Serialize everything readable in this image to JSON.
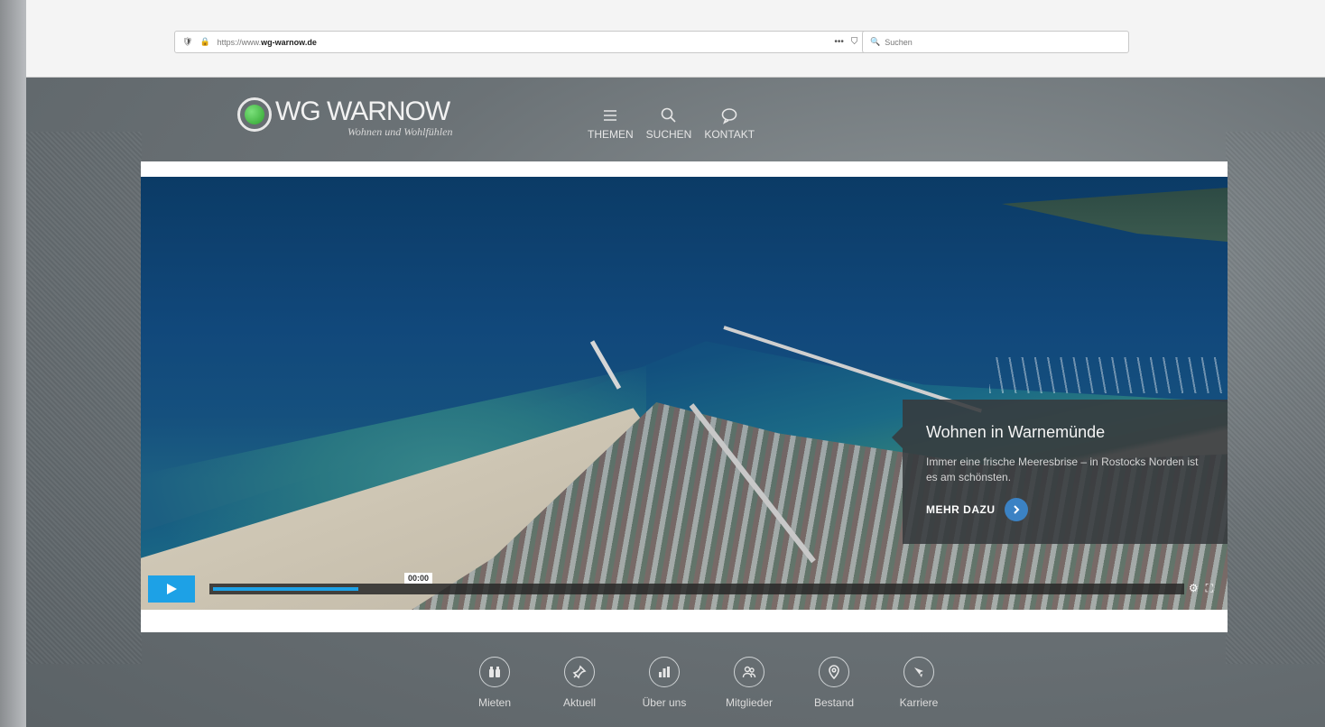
{
  "browser": {
    "url_prefix": "https://www.",
    "url_domain": "wg-warnow.de",
    "search_placeholder": "Suchen",
    "more_glyph": "•••"
  },
  "brand": {
    "name": "WG WARNOW",
    "tagline": "Wohnen und Wohlfühlen",
    "logo_color": "#3bb53b"
  },
  "topnav": [
    {
      "label": "THEMEN",
      "icon": "menu-icon"
    },
    {
      "label": "SUCHEN",
      "icon": "search-icon"
    },
    {
      "label": "KONTAKT",
      "icon": "chat-icon"
    }
  ],
  "hero": {
    "title": "Wohnen in Warnemünde",
    "text": "Immer eine frische Meeresbrise – in Rostocks Norden ist es am schönsten.",
    "cta": "MEHR DAZU",
    "accent": "#3b82c4"
  },
  "player": {
    "time": "00:00",
    "progress": 0.15,
    "accent": "#1da1e6"
  },
  "bottomnav": [
    {
      "label": "Mieten",
      "icon": "binoculars-icon"
    },
    {
      "label": "Aktuell",
      "icon": "pin-icon"
    },
    {
      "label": "Über uns",
      "icon": "chart-icon"
    },
    {
      "label": "Mitglieder",
      "icon": "users-icon"
    },
    {
      "label": "Bestand",
      "icon": "location-icon"
    },
    {
      "label": "Karriere",
      "icon": "rocket-icon"
    }
  ]
}
